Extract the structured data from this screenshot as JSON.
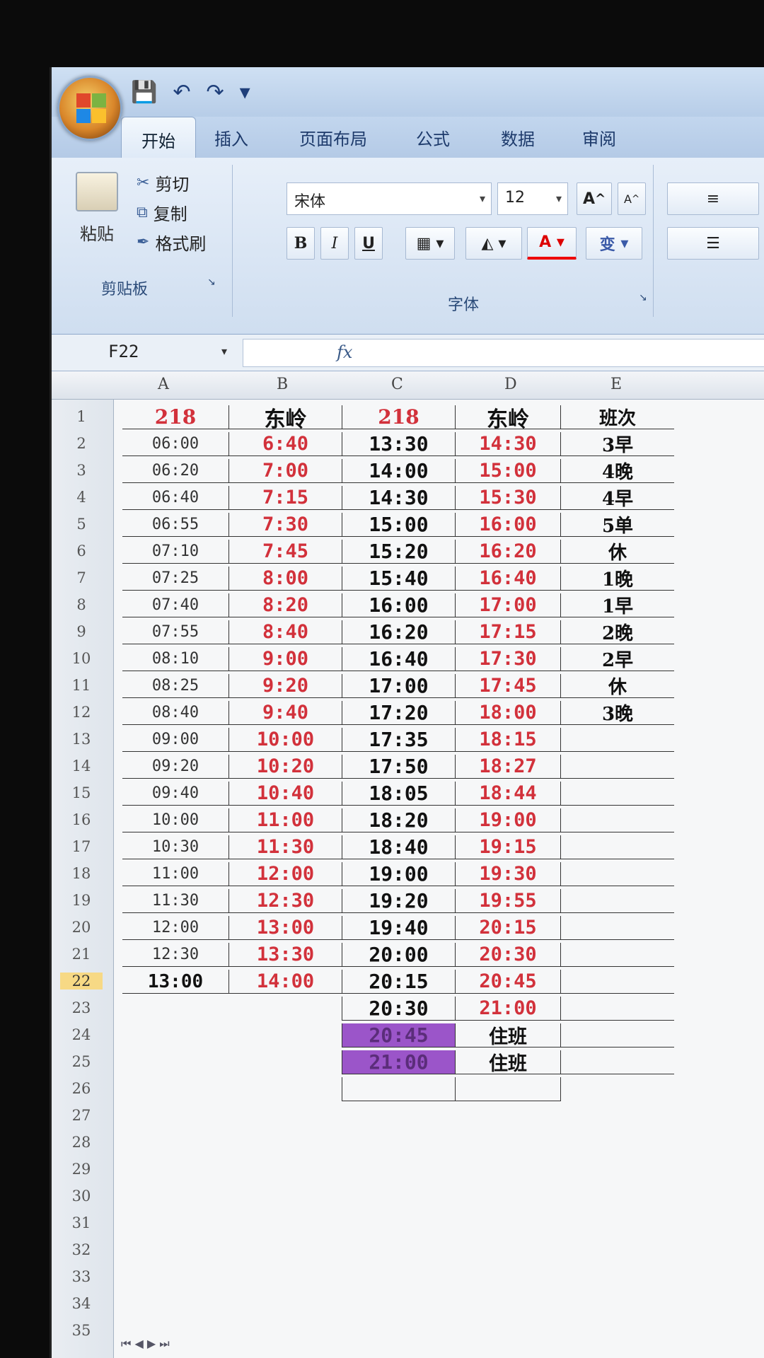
{
  "app": {
    "quick_access": [
      "save-icon",
      "undo-icon",
      "redo-icon",
      "customize-icon"
    ]
  },
  "tabs": [
    "开始",
    "插入",
    "页面布局",
    "公式",
    "数据",
    "审阅"
  ],
  "ribbon": {
    "clipboard": {
      "paste": "粘贴",
      "cut": "剪切",
      "copy": "复制",
      "format_painter": "格式刷",
      "group_label": "剪贴板"
    },
    "font": {
      "name": "宋体",
      "size": "12",
      "bold": "B",
      "italic": "I",
      "underline": "U",
      "grow": "A",
      "shrink": "A",
      "font_color": "A",
      "phonetic": "变",
      "group_label": "字体"
    }
  },
  "formula_bar": {
    "name_box": "F22",
    "fx": "fx",
    "value": ""
  },
  "columns": [
    "A",
    "B",
    "C",
    "D",
    "E"
  ],
  "rows": [
    {
      "n": "1",
      "A": "218",
      "B": "东岭",
      "C": "218",
      "D": "东岭",
      "E": "班次"
    },
    {
      "n": "2",
      "A": "06:00",
      "B": "6:40",
      "C": "13:30",
      "D": "14:30",
      "E": "3早"
    },
    {
      "n": "3",
      "A": "06:20",
      "B": "7:00",
      "C": "14:00",
      "D": "15:00",
      "E": "4晚"
    },
    {
      "n": "4",
      "A": "06:40",
      "B": "7:15",
      "C": "14:30",
      "D": "15:30",
      "E": "4早"
    },
    {
      "n": "5",
      "A": "06:55",
      "B": "7:30",
      "C": "15:00",
      "D": "16:00",
      "E": "5单"
    },
    {
      "n": "6",
      "A": "07:10",
      "B": "7:45",
      "C": "15:20",
      "D": "16:20",
      "E": "休"
    },
    {
      "n": "7",
      "A": "07:25",
      "B": "8:00",
      "C": "15:40",
      "D": "16:40",
      "E": "1晚"
    },
    {
      "n": "8",
      "A": "07:40",
      "B": "8:20",
      "C": "16:00",
      "D": "17:00",
      "E": "1早"
    },
    {
      "n": "9",
      "A": "07:55",
      "B": "8:40",
      "C": "16:20",
      "D": "17:15",
      "E": "2晚"
    },
    {
      "n": "10",
      "A": "08:10",
      "B": "9:00",
      "C": "16:40",
      "D": "17:30",
      "E": "2早"
    },
    {
      "n": "11",
      "A": "08:25",
      "B": "9:20",
      "C": "17:00",
      "D": "17:45",
      "E": "休"
    },
    {
      "n": "12",
      "A": "08:40",
      "B": "9:40",
      "C": "17:20",
      "D": "18:00",
      "E": "3晚"
    },
    {
      "n": "13",
      "A": "09:00",
      "B": "10:00",
      "C": "17:35",
      "D": "18:15",
      "E": ""
    },
    {
      "n": "14",
      "A": "09:20",
      "B": "10:20",
      "C": "17:50",
      "D": "18:27",
      "E": ""
    },
    {
      "n": "15",
      "A": "09:40",
      "B": "10:40",
      "C": "18:05",
      "D": "18:44",
      "E": ""
    },
    {
      "n": "16",
      "A": "10:00",
      "B": "11:00",
      "C": "18:20",
      "D": "19:00",
      "E": ""
    },
    {
      "n": "17",
      "A": "10:30",
      "B": "11:30",
      "C": "18:40",
      "D": "19:15",
      "E": ""
    },
    {
      "n": "18",
      "A": "11:00",
      "B": "12:00",
      "C": "19:00",
      "D": "19:30",
      "E": ""
    },
    {
      "n": "19",
      "A": "11:30",
      "B": "12:30",
      "C": "19:20",
      "D": "19:55",
      "E": ""
    },
    {
      "n": "20",
      "A": "12:00",
      "B": "13:00",
      "C": "19:40",
      "D": "20:15",
      "E": ""
    },
    {
      "n": "21",
      "A": "12:30",
      "B": "13:30",
      "C": "20:00",
      "D": "20:30",
      "E": ""
    },
    {
      "n": "22",
      "A": "13:00",
      "B": "14:00",
      "C": "20:15",
      "D": "20:45",
      "E": ""
    },
    {
      "n": "23",
      "A": "",
      "B": "",
      "C": "20:30",
      "D": "21:00",
      "E": ""
    },
    {
      "n": "24",
      "A": "",
      "B": "",
      "C": "20:45",
      "D": "住班",
      "E": ""
    },
    {
      "n": "25",
      "A": "",
      "B": "",
      "C": "21:00",
      "D": "住班",
      "E": ""
    },
    {
      "n": "26",
      "A": "",
      "B": "",
      "C": "",
      "D": "",
      "E": ""
    }
  ],
  "extra_row_numbers": [
    "27",
    "28",
    "29",
    "30",
    "31",
    "32",
    "33",
    "34",
    "35"
  ],
  "selected_row": "22",
  "colors": {
    "red_text": "#d2313b",
    "purple_fill": "#9b55c9",
    "selected_row_header": "#f7d985"
  }
}
